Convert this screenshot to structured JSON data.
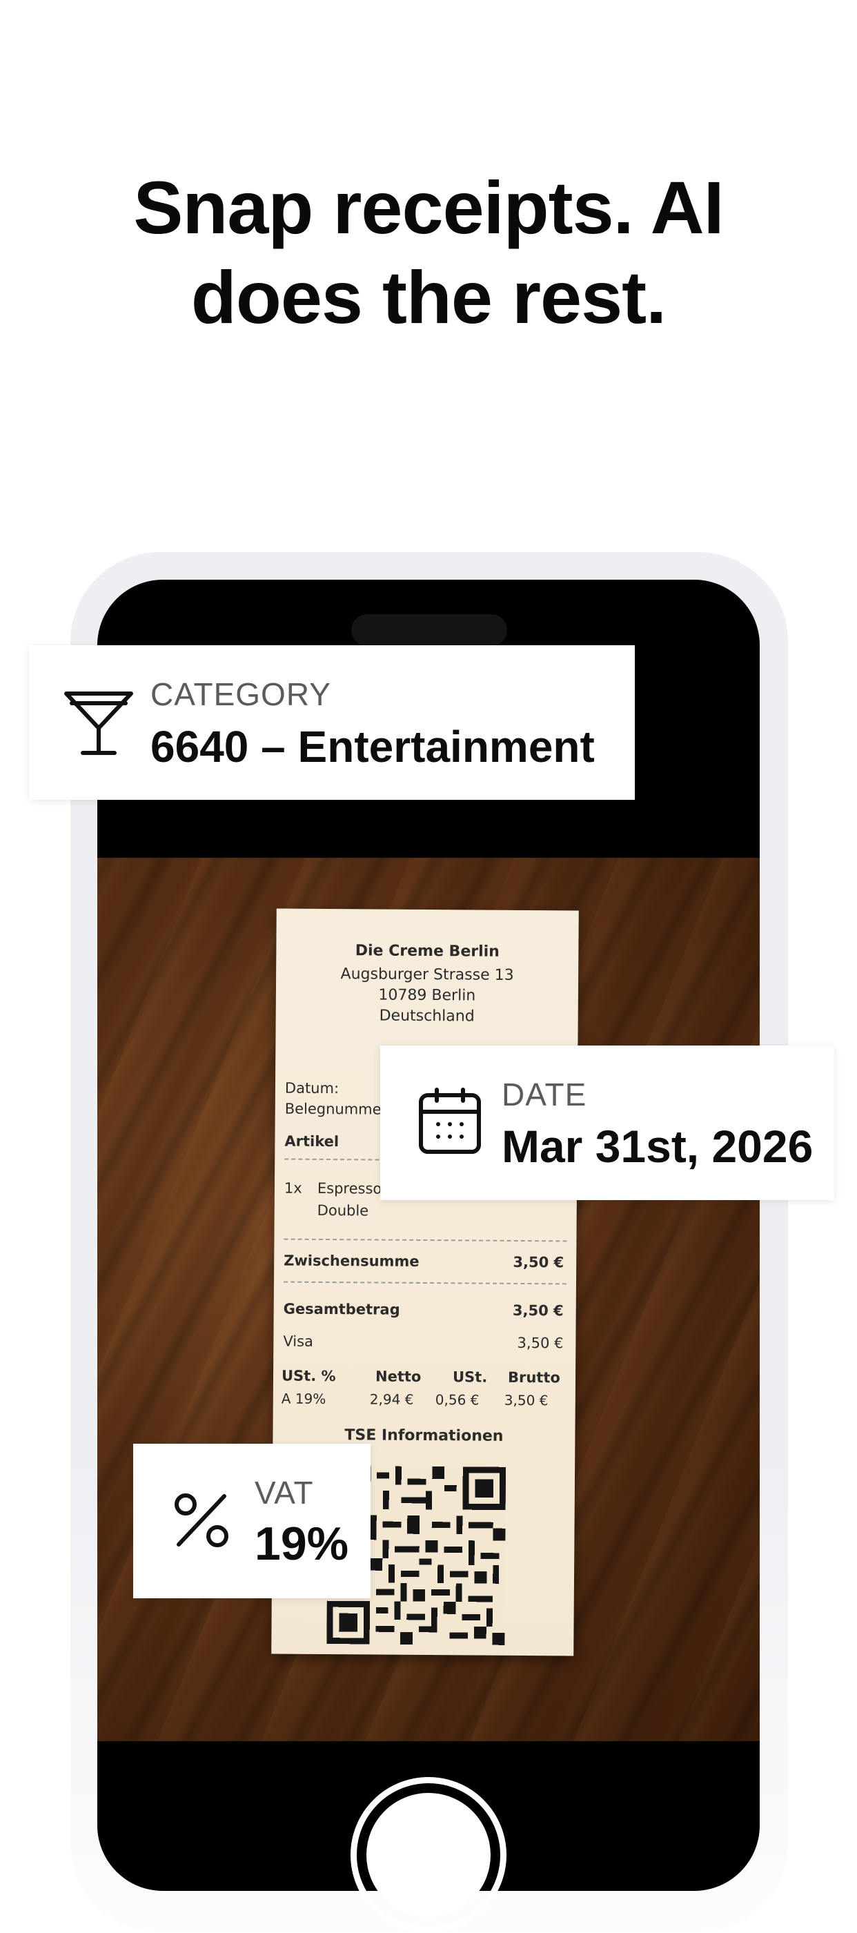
{
  "headline": {
    "line1": "Snap receipts. AI",
    "line2": "does the rest."
  },
  "cards": {
    "category": {
      "label": "CATEGORY",
      "value": "6640 – Entertainment",
      "icon": "cocktail-glass-icon"
    },
    "date": {
      "label": "DATE",
      "value": "Mar 31st, 2026",
      "icon": "calendar-icon"
    },
    "vat": {
      "label": "VAT",
      "value": "19%",
      "icon": "percent-icon"
    }
  },
  "receipt": {
    "shop": "Die Creme Berlin",
    "address1": "Augsburger Strasse 13",
    "address2": "10789 Berlin",
    "country": "Deutschland",
    "datum": "Datum:",
    "belegnummer": "Belegnumme",
    "artikel": "Artikel",
    "qty": "1x",
    "item": "Espresso",
    "item_variant": "Double",
    "subtotal_label": "Zwischensumme",
    "subtotal_value": "3,50 €",
    "total_label": "Gesamtbetrag",
    "total_value": "3,50 €",
    "payment_label": "Visa",
    "payment_value": "3,50 €",
    "vat_headers": [
      "USt. %",
      "Netto",
      "USt.",
      "Brutto"
    ],
    "vat_row": [
      "A 19%",
      "2,94 €",
      "0,56 €",
      "3,50 €"
    ],
    "tse": "TSE Informationen"
  },
  "colors": {
    "background": "#ffffff",
    "phone_frame": "#eeeff3",
    "screen": "#000000",
    "card": "#ffffff"
  }
}
